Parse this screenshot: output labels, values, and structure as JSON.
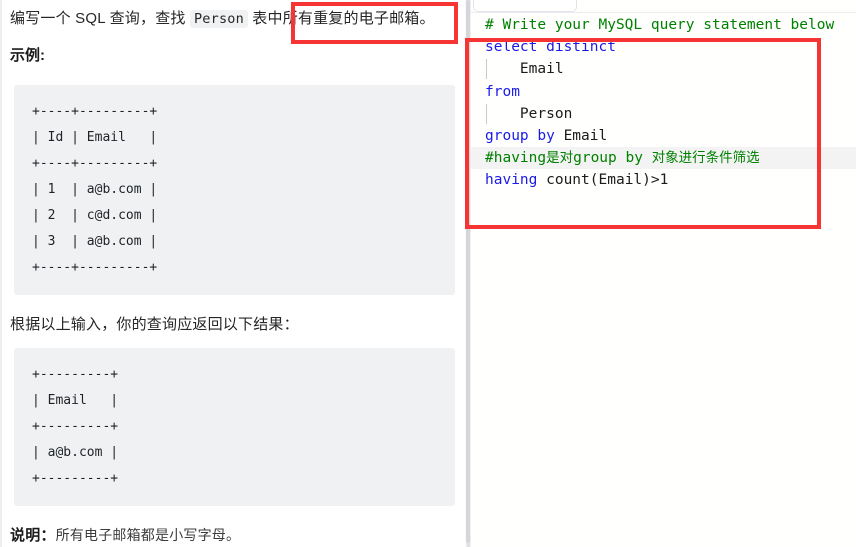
{
  "problem": {
    "intro_prefix": "编写一个 SQL 查询，查找 ",
    "intro_code": "Person",
    "intro_suffix": " 表中所有重复的电子邮箱。",
    "example_heading": "示例:",
    "input_table": "+----+---------+\n| Id | Email   |\n+----+---------+\n| 1  | a@b.com |\n| 2  | c@d.com |\n| 3  | a@b.com |\n+----+---------+",
    "result_lead": "根据以上输入，你的查询应返回以下结果：",
    "output_table": "+---------+\n| Email   |\n+---------+\n| a@b.com |\n+---------+",
    "note_label": "说明：",
    "note_text": "所有电子邮箱都是小写字母。"
  },
  "editor": {
    "lines": [
      {
        "id": "line-comment-header",
        "indent_guide": false,
        "highlight": false,
        "tokens": [
          {
            "text": "# Write your MySQL query statement below",
            "type": "comment"
          }
        ]
      },
      {
        "id": "line-select-distinct",
        "indent_guide": false,
        "highlight": false,
        "tokens": [
          {
            "text": "select distinct",
            "type": "keyword"
          }
        ]
      },
      {
        "id": "line-email-col",
        "indent_guide": true,
        "highlight": false,
        "tokens": [
          {
            "text": "    Email",
            "type": "identifier"
          }
        ]
      },
      {
        "id": "line-from",
        "indent_guide": false,
        "highlight": false,
        "tokens": [
          {
            "text": "from",
            "type": "keyword"
          }
        ]
      },
      {
        "id": "line-person-table",
        "indent_guide": true,
        "highlight": false,
        "tokens": [
          {
            "text": "    Person",
            "type": "identifier"
          }
        ]
      },
      {
        "id": "line-group-by",
        "indent_guide": false,
        "highlight": false,
        "tokens": [
          {
            "text": "group by",
            "type": "keyword"
          },
          {
            "text": " Email",
            "type": "identifier"
          }
        ]
      },
      {
        "id": "line-comment-having",
        "indent_guide": false,
        "highlight": true,
        "tokens": [
          {
            "text": "#having是对group by 对象进行条件筛选",
            "type": "comment"
          }
        ]
      },
      {
        "id": "line-having",
        "indent_guide": false,
        "highlight": false,
        "tokens": [
          {
            "text": "having",
            "type": "keyword"
          },
          {
            "text": " count(Email)>1",
            "type": "identifier"
          }
        ]
      }
    ]
  },
  "annotations": {
    "color": "#f73434",
    "boxes": [
      {
        "id": "annot-left",
        "target": "所有重复的电子邮箱。"
      },
      {
        "id": "annot-right",
        "target": "SQL solution body"
      }
    ]
  }
}
